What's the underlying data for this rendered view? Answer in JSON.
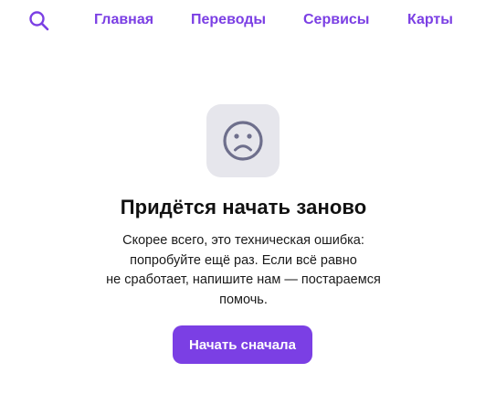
{
  "nav": {
    "search_icon": "search-icon",
    "items": [
      {
        "label": "Главная"
      },
      {
        "label": "Переводы"
      },
      {
        "label": "Сервисы"
      },
      {
        "label": "Карты"
      }
    ]
  },
  "error": {
    "icon": "sad-face-icon",
    "title": "Придётся начать заново",
    "lines": [
      "Скорее всего, это техническая ошибка:",
      "попробуйте ещё раз. Если всё равно",
      "не сработает, напишите нам — постараемся",
      "помочь."
    ],
    "button_label": "Начать сначала"
  },
  "colors": {
    "accent": "#7b3fe4",
    "tile_background": "#e6e6ec",
    "icon_stroke": "#6e6f8c",
    "text": "#1a1a1a"
  }
}
